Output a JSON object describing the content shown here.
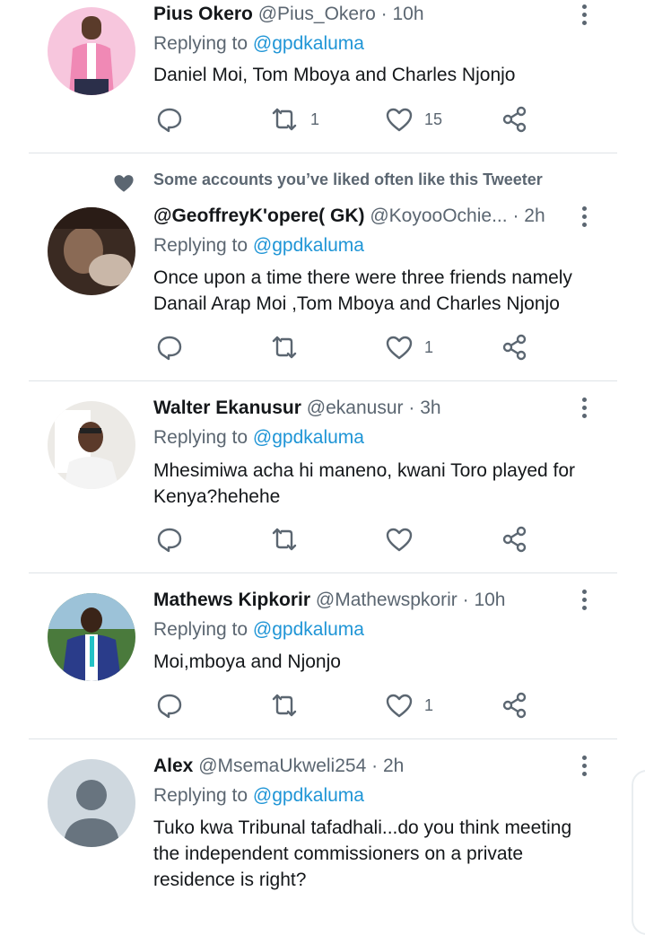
{
  "tweets": [
    {
      "name": "Pius Okero",
      "handle": "@Pius_Okero",
      "time": "10h",
      "replying_prefix": "Replying to",
      "replying_to": "@gpdkaluma",
      "text": "Daniel Moi, Tom Mboya and Charles Njonjo",
      "retweets": "1",
      "likes": "15"
    },
    {
      "social_context": "Some accounts you’ve liked often like this Tweeter",
      "name": "@GeoffreyK'opere( GK)",
      "handle": "@KoyooOchie...",
      "time": "2h",
      "replying_prefix": "Replying to",
      "replying_to": "@gpdkaluma",
      "text": "Once upon a time there were three friends namely Danail Arap Moi ,Tom Mboya and Charles Njonjo",
      "retweets": "",
      "likes": "1"
    },
    {
      "name": "Walter Ekanusur",
      "handle": "@ekanusur",
      "time": "3h",
      "replying_prefix": "Replying to",
      "replying_to": "@gpdkaluma",
      "text": "Mhesimiwa acha hi maneno, kwani Toro played for Kenya?hehehe",
      "retweets": "",
      "likes": ""
    },
    {
      "name": "Mathews Kipkorir",
      "handle": "@Mathewspkorir",
      "time": "10h",
      "replying_prefix": "Replying to",
      "replying_to": "@gpdkaluma",
      "text": "Moi,mboya and Njonjo",
      "retweets": "",
      "likes": "1"
    },
    {
      "name": "Alex",
      "handle": "@MsemaUkweli254",
      "time": "2h",
      "replying_prefix": "Replying to",
      "replying_to": "@gpdkaluma",
      "text": "Tuko kwa Tribunal tafadhali...do you think meeting the independent commissioners on a private residence is right?"
    }
  ],
  "separator": "·",
  "icons": [
    "reply-icon",
    "retweet-icon",
    "like-icon",
    "share-icon",
    "more-icon",
    "heart-context-icon"
  ],
  "colors": {
    "mention": "#1f95d6",
    "muted": "#5b6671",
    "text": "#14171a",
    "divider": "#dfe3e7"
  }
}
